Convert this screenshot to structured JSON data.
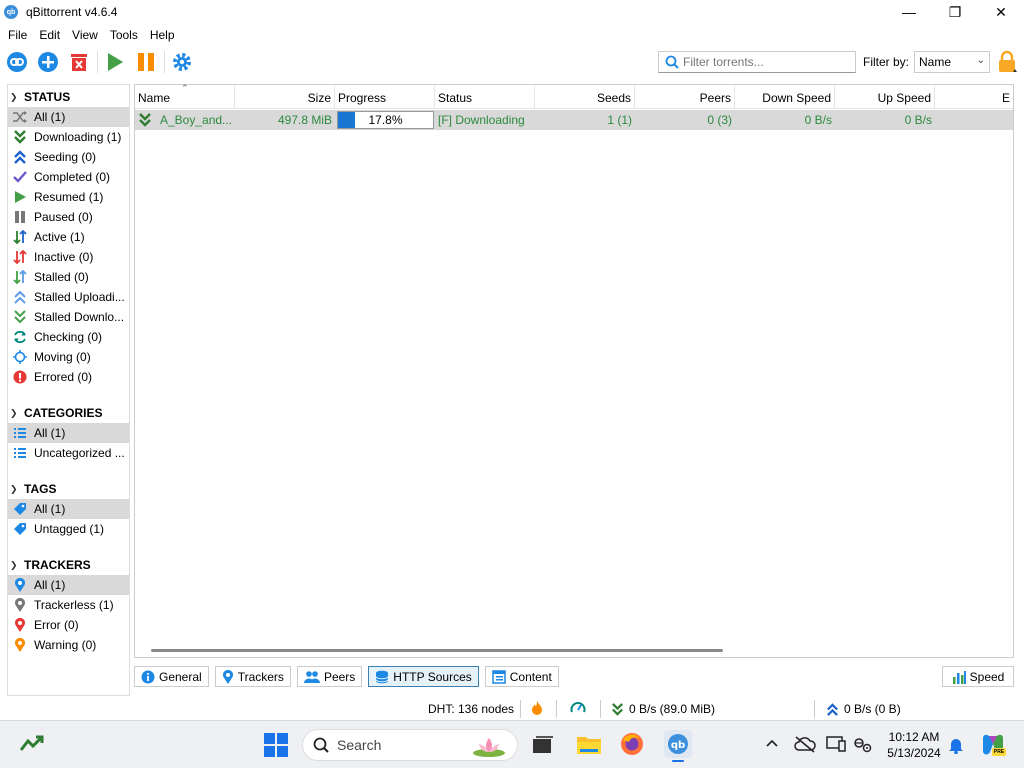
{
  "window": {
    "title": "qBittorrent v4.6.4",
    "app_icon_text": "qb",
    "minimize": "—",
    "maximize": "❐",
    "close": "✕"
  },
  "menu": [
    "File",
    "Edit",
    "View",
    "Tools",
    "Help"
  ],
  "toolbar": {
    "filter_placeholder": "Filter torrents...",
    "filter_by_label": "Filter by:",
    "filter_by_value": "Name"
  },
  "sidebar": {
    "status": {
      "header": "STATUS",
      "items": [
        {
          "label": "All (1)",
          "icon": "shuffle-icon"
        },
        {
          "label": "Downloading (1)",
          "icon": "double-chevron-down-icon"
        },
        {
          "label": "Seeding (0)",
          "icon": "double-chevron-up-icon"
        },
        {
          "label": "Completed (0)",
          "icon": "checkmark-icon"
        },
        {
          "label": "Resumed (1)",
          "icon": "play-icon"
        },
        {
          "label": "Paused (0)",
          "icon": "pause-icon"
        },
        {
          "label": "Active (1)",
          "icon": "active-arrows-icon"
        },
        {
          "label": "Inactive (0)",
          "icon": "inactive-arrows-icon"
        },
        {
          "label": "Stalled (0)",
          "icon": "stalled-arrows-icon"
        },
        {
          "label": "Stalled Uploadi...",
          "icon": "stalled-up-icon"
        },
        {
          "label": "Stalled Downlo...",
          "icon": "stalled-down-icon"
        },
        {
          "label": "Checking (0)",
          "icon": "refresh-icon"
        },
        {
          "label": "Moving (0)",
          "icon": "moving-icon"
        },
        {
          "label": "Errored (0)",
          "icon": "error-icon"
        }
      ]
    },
    "categories": {
      "header": "CATEGORIES",
      "items": [
        {
          "label": "All (1)",
          "icon": "list-icon"
        },
        {
          "label": "Uncategorized ...",
          "icon": "list-icon"
        }
      ]
    },
    "tags": {
      "header": "TAGS",
      "items": [
        {
          "label": "All (1)",
          "icon": "tag-icon"
        },
        {
          "label": "Untagged (1)",
          "icon": "tag-icon"
        }
      ]
    },
    "trackers": {
      "header": "TRACKERS",
      "items": [
        {
          "label": "All (1)",
          "icon": "pin-blue-icon"
        },
        {
          "label": "Trackerless (1)",
          "icon": "pin-gray-icon"
        },
        {
          "label": "Error (0)",
          "icon": "pin-red-icon"
        },
        {
          "label": "Warning (0)",
          "icon": "pin-orange-icon"
        }
      ]
    }
  },
  "table": {
    "columns": [
      "Name",
      "Size",
      "Progress",
      "Status",
      "Seeds",
      "Peers",
      "Down Speed",
      "Up Speed",
      "E"
    ],
    "rows": [
      {
        "name": "A_Boy_and...",
        "size": "497.8 MiB",
        "progress": 0.178,
        "progress_text": "17.8%",
        "status": "[F] Downloading",
        "seeds": "1 (1)",
        "peers": "0 (3)",
        "down_speed": "0 B/s",
        "up_speed": "0 B/s"
      }
    ]
  },
  "tabs": [
    {
      "label": "General",
      "icon": "info-icon"
    },
    {
      "label": "Trackers",
      "icon": "pin-icon"
    },
    {
      "label": "Peers",
      "icon": "people-icon"
    },
    {
      "label": "HTTP Sources",
      "icon": "database-icon"
    },
    {
      "label": "Content",
      "icon": "content-icon"
    }
  ],
  "speed_button": "Speed",
  "statusbar": {
    "dht": "DHT: 136 nodes",
    "download": "0 B/s (89.0 MiB)",
    "upload": "0 B/s (0 B)"
  },
  "taskbar": {
    "search_placeholder": "Search",
    "time": "10:12 AM",
    "date": "5/13/2024",
    "copilot_badge": "PRE"
  },
  "colors": {
    "accent_blue": "#1976d2",
    "downloading_green": "#2b8a3e",
    "selection_gray": "#d9d9d9"
  }
}
